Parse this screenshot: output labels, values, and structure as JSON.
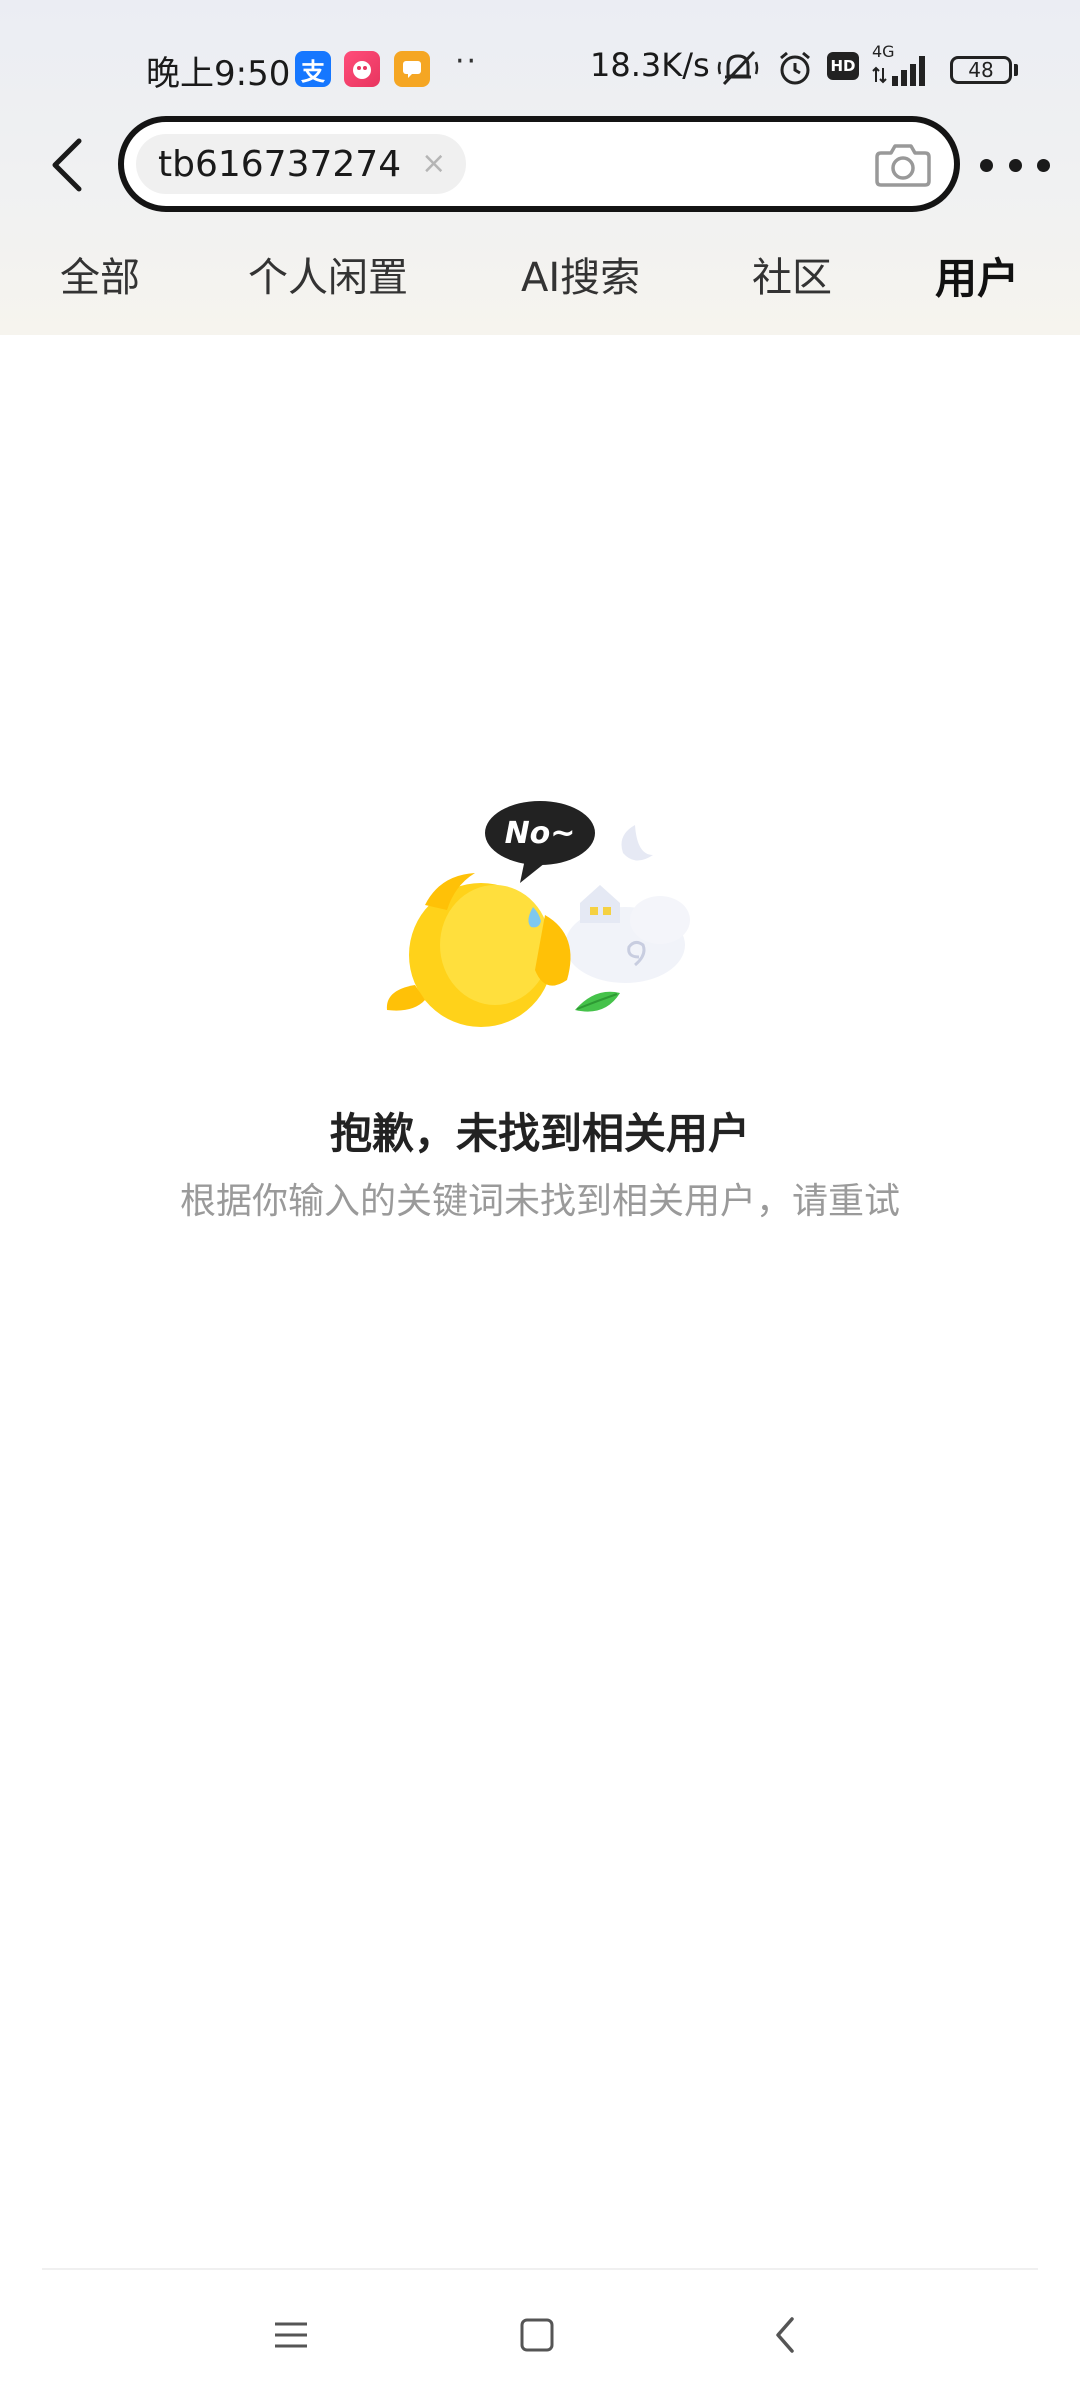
{
  "status_bar": {
    "time": "晚上9:50",
    "alipay_icon_char": "支",
    "more_notifications": "··",
    "network_speed": "18.3K/s",
    "hd_label": "HD",
    "network_type": "4G",
    "battery_level": "48"
  },
  "search": {
    "query": "tb616737274",
    "clear_symbol": "×"
  },
  "tabs": [
    {
      "label": "全部",
      "active": false
    },
    {
      "label": "个人闲置",
      "active": false
    },
    {
      "label": "AI搜索",
      "active": false
    },
    {
      "label": "社区",
      "active": false
    },
    {
      "label": "用户",
      "active": true
    }
  ],
  "empty_state": {
    "bubble_text": "No~",
    "title": "抱歉，未找到相关用户",
    "subtitle": "根据你输入的关键词未找到相关用户，请重试"
  },
  "colors": {
    "accent_yellow": "#ffe60f",
    "search_border": "#141414",
    "subtitle_gray": "#9a9a9a"
  }
}
